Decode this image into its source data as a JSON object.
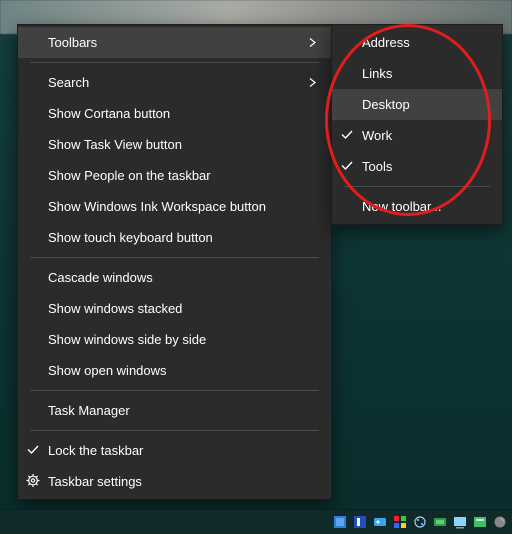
{
  "main_menu": {
    "items": [
      {
        "label": "Toolbars",
        "has_submenu": true,
        "highlight": true
      },
      {
        "separator": true
      },
      {
        "label": "Search",
        "has_submenu": true
      },
      {
        "label": "Show Cortana button"
      },
      {
        "label": "Show Task View button"
      },
      {
        "label": "Show People on the taskbar"
      },
      {
        "label": "Show Windows Ink Workspace button"
      },
      {
        "label": "Show touch keyboard button"
      },
      {
        "separator": true
      },
      {
        "label": "Cascade windows"
      },
      {
        "label": "Show windows stacked"
      },
      {
        "label": "Show windows side by side"
      },
      {
        "label": "Show open windows"
      },
      {
        "separator": true
      },
      {
        "label": "Task Manager"
      },
      {
        "separator": true
      },
      {
        "label": "Lock the taskbar",
        "checked": true
      },
      {
        "label": "Taskbar settings",
        "icon": "gear-icon"
      }
    ]
  },
  "sub_menu": {
    "items": [
      {
        "label": "Address"
      },
      {
        "label": "Links"
      },
      {
        "label": "Desktop",
        "highlight": true
      },
      {
        "label": "Work",
        "checked": true
      },
      {
        "label": "Tools",
        "checked": true
      },
      {
        "separator": true
      },
      {
        "label": "New toolbar..."
      }
    ]
  },
  "annotation": {
    "type": "ellipse",
    "color": "#e11d1d"
  },
  "tray_icons": [
    "app-icon-1",
    "app-icon-2",
    "app-icon-3",
    "app-icon-4",
    "app-icon-5",
    "app-icon-6",
    "app-icon-7",
    "app-icon-8",
    "app-icon-9"
  ]
}
